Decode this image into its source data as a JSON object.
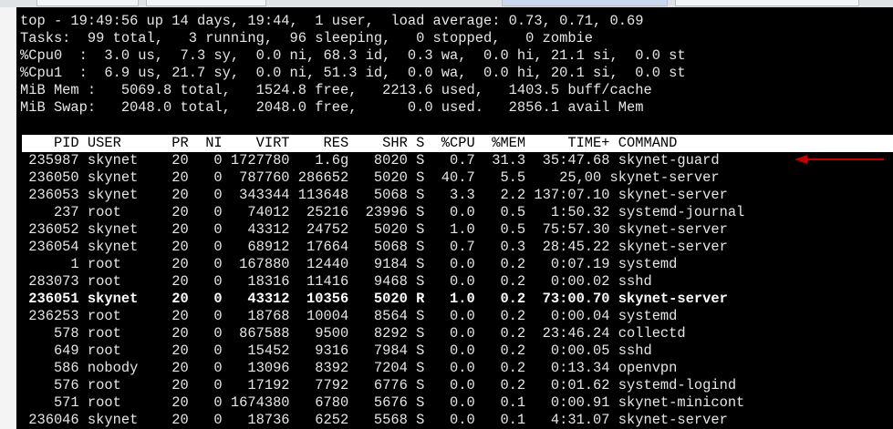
{
  "summary": [
    "top - 19:49:56 up 14 days, 19:44,  1 user,  load average: 0.73, 0.71, 0.69",
    "Tasks:  99 total,   3 running,  96 sleeping,   0 stopped,   0 zombie",
    "%Cpu0  :  3.0 us,  7.3 sy,  0.0 ni, 68.3 id,  0.3 wa,  0.0 hi, 21.1 si,  0.0 st",
    "%Cpu1  :  6.9 us, 21.7 sy,  0.0 ni, 51.3 id,  0.0 wa,  0.0 hi, 20.1 si,  0.0 st",
    "MiB Mem :   5069.8 total,   1524.8 free,   2213.6 used,   1403.5 buff/cache",
    "MiB Swap:   2048.0 total,   2048.0 free,      0.0 used.   2856.1 avail Mem"
  ],
  "header": "    PID USER      PR  NI    VIRT    RES    SHR S  %CPU  %MEM     TIME+ COMMAND",
  "processes": [
    " 235987 skynet    20   0 1727780   1.6g   8020 S   0.7  31.3  35:47.68 skynet-guard",
    " 236050 skynet    20   0  787760 286652   5020 S  40.7   5.5    25,00 skynet-server",
    " 236053 skynet    20   0  343344 113648   5068 S   3.3   2.2 137:07.10 skynet-server",
    "    237 root      20   0   74012  25216  23996 S   0.0   0.5   1:50.32 systemd-journal",
    " 236052 skynet    20   0   43312  24752   5020 S   1.0   0.5  75:57.30 skynet-server",
    " 236054 skynet    20   0   68912  17664   5068 S   0.7   0.3  28:45.22 skynet-server",
    "      1 root      20   0  167880  12440   9184 S   0.0   0.2   0:07.19 systemd",
    " 283073 root      20   0   18316  11416   9468 S   0.0   0.2   0:00.02 sshd",
    " 236051 skynet    20   0   43312  10356   5020 R   1.0   0.2  73:00.70 skynet-server",
    " 236253 root      20   0   18768  10004   8564 S   0.0   0.2   0:00.04 systemd",
    "    578 root      20   0  867588   9500   8292 S   0.0   0.2  23:46.24 collectd",
    "    649 root      20   0   15452   9316   7984 S   0.0   0.2   0:00.05 sshd",
    "    586 nobody    20   0   13096   8392   7204 S   0.0   0.2   0:13.34 openvpn",
    "    576 root      20   0   17192   7792   6776 S   0.0   0.2   0:01.62 systemd-logind",
    "    571 root      20   0 1674380   6780   5676 S   0.0   0.1   0:00.91 skynet-minicont",
    " 236046 skynet    20   0   18736   6252   5568 S   0.0   0.1   4:31.07 skynet-server"
  ],
  "colors": {
    "background": "#000000",
    "text": "#e6e6e6",
    "header_bg": "#ffffff",
    "arrow": "#c00000"
  }
}
